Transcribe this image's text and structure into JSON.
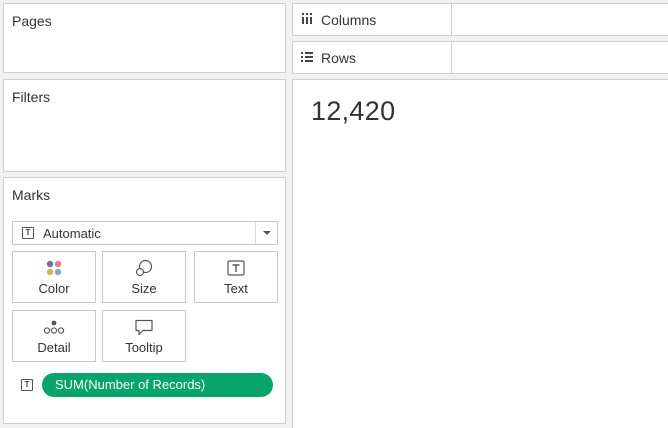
{
  "cards": {
    "pages": "Pages",
    "filters": "Filters",
    "marks": "Marks"
  },
  "shelves": {
    "columns": {
      "label": "Columns",
      "icon": "columns-icon"
    },
    "rows": {
      "label": "Rows",
      "icon": "rows-icon"
    }
  },
  "marks": {
    "mark_type": "Automatic",
    "buttons": {
      "color": "Color",
      "size": "Size",
      "text": "Text",
      "detail": "Detail",
      "tooltip": "Tooltip"
    },
    "pill": "SUM(Number of Records)",
    "pill_color": "#07a56b",
    "color_dots": [
      "#7b6ba6",
      "#ee7b7a",
      "#f0a854",
      "#7da7d4"
    ]
  },
  "view": {
    "value": "12,420"
  }
}
